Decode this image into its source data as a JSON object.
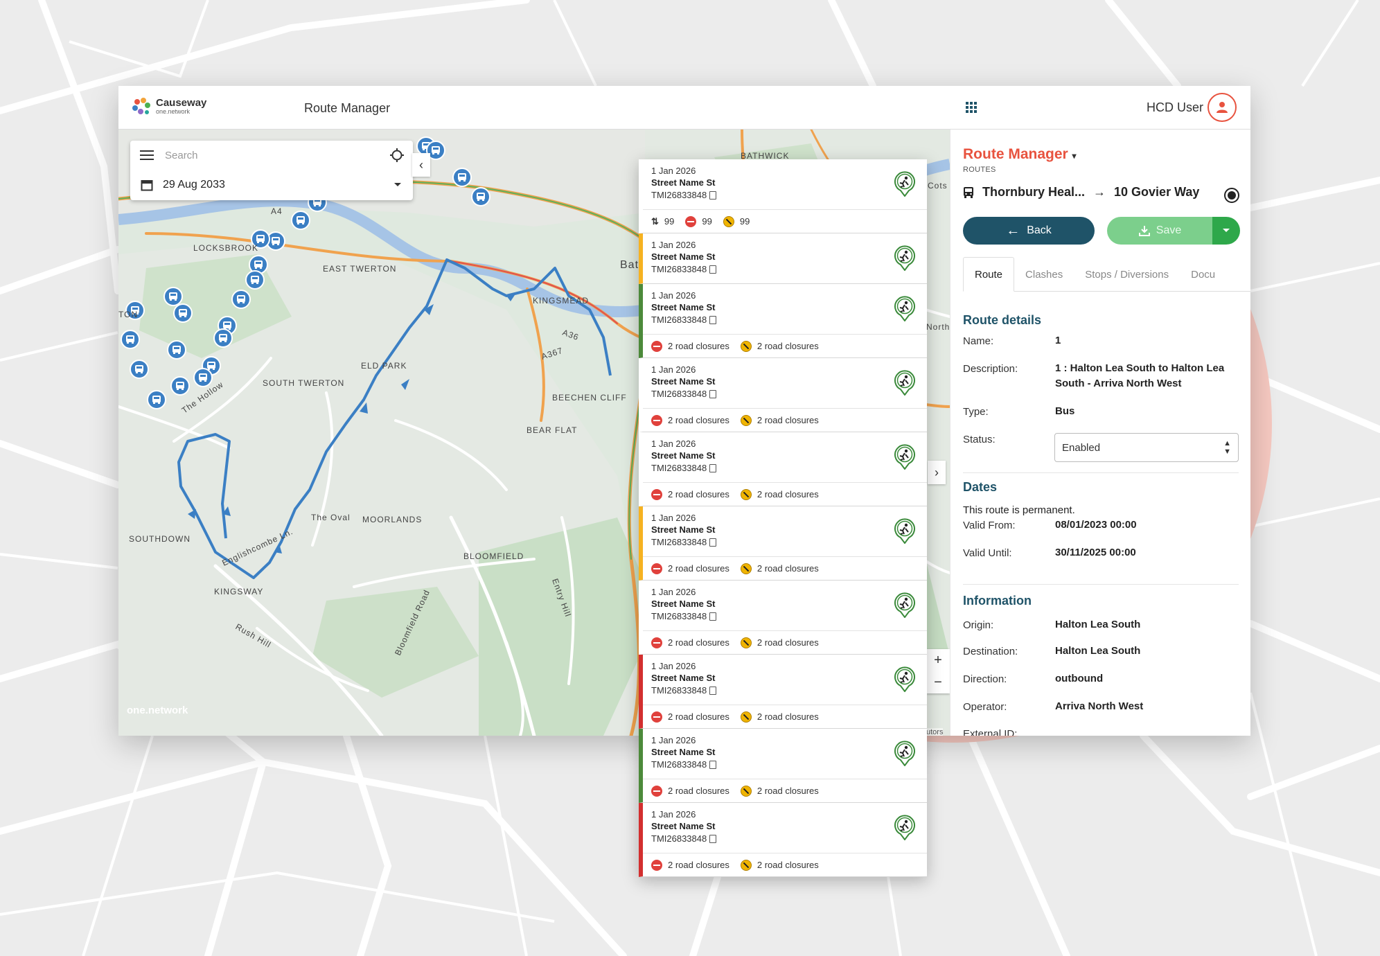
{
  "app": {
    "brand_name": "Causeway",
    "brand_sub": "one.network",
    "title": "Route Manager",
    "user_name": "HCD User"
  },
  "search": {
    "placeholder": "Search",
    "date": "29 Aug 2033"
  },
  "map": {
    "attribution": "one.network",
    "contributors": "utors",
    "labels": [
      "LOCKSBROOK",
      "EAST TWERTON",
      "KINGSMEAD",
      "A4",
      "A36",
      "A367",
      "Bat",
      "TON",
      "The Hollow",
      "SOUTH TWERTON",
      "ELD PARK",
      "BEECHEN CLIFF",
      "BEAR FLAT",
      "The Oval",
      "MOORLANDS",
      "SOUTHDOWN",
      "BLOOMFIELD",
      "KINGSWAY",
      "Englishcombe Ln.",
      "Rush Hill",
      "Bloomfield Road",
      "Entry Hill",
      "BATHWICK",
      "North",
      "Cots"
    ],
    "zoom_in": "+",
    "zoom_out": "−"
  },
  "events": {
    "summary": {
      "diversions": "99",
      "closures": "99",
      "restrictions": "99"
    },
    "items": [
      {
        "date": "1 Jan 2026",
        "street": "Street Name St",
        "ref": "TMI26833848",
        "status_color": "#ffffff",
        "closures": "",
        "restrictions": ""
      },
      {
        "date": "1 Jan 2026",
        "street": "Street Name St",
        "ref": "TMI26833848",
        "status_color": "#f6b221",
        "closures": "",
        "restrictions": ""
      },
      {
        "date": "1 Jan 2026",
        "street": "Street Name St",
        "ref": "TMI26833848",
        "status_color": "#4c8a3a",
        "closures": "2 road closures",
        "restrictions": "2 road closures"
      },
      {
        "date": "1 Jan 2026",
        "street": "Street Name St",
        "ref": "TMI26833848",
        "status_color": "#ffffff",
        "closures": "2 road closures",
        "restrictions": "2 road closures"
      },
      {
        "date": "1 Jan 2026",
        "street": "Street Name St",
        "ref": "TMI26833848",
        "status_color": "#ffffff",
        "closures": "2 road closures",
        "restrictions": "2 road closures"
      },
      {
        "date": "1 Jan 2026",
        "street": "Street Name St",
        "ref": "TMI26833848",
        "status_color": "#f6b221",
        "closures": "2 road closures",
        "restrictions": "2 road closures"
      },
      {
        "date": "1 Jan 2026",
        "street": "Street Name St",
        "ref": "TMI26833848",
        "status_color": "#ffffff",
        "closures": "2 road closures",
        "restrictions": "2 road closures"
      },
      {
        "date": "1 Jan 2026",
        "street": "Street Name St",
        "ref": "TMI26833848",
        "status_color": "#d32f2f",
        "closures": "2 road closures",
        "restrictions": "2 road closures"
      },
      {
        "date": "1 Jan 2026",
        "street": "Street Name St",
        "ref": "TMI26833848",
        "status_color": "#4c8a3a",
        "closures": "2 road closures",
        "restrictions": "2 road closures"
      },
      {
        "date": "1 Jan 2026",
        "street": "Street Name St",
        "ref": "TMI26833848",
        "status_color": "#d32f2f",
        "closures": "2 road closures",
        "restrictions": "2 road closures"
      }
    ]
  },
  "side": {
    "title": "Route Manager",
    "subtitle": "ROUTES",
    "route_from": "Thornbury Heal...",
    "route_to": "10 Govier Way",
    "back_label": "Back",
    "save_label": "Save",
    "tabs": [
      "Route",
      "Clashes",
      "Stops / Diversions",
      "Docu"
    ],
    "route_details_title": "Route details",
    "name_label": "Name:",
    "name_value": "1",
    "description_label": "Description:",
    "description_value": "1 : Halton Lea South to Halton Lea South - Arriva North West",
    "type_label": "Type:",
    "type_value": "Bus",
    "status_label": "Status:",
    "status_value": "Enabled",
    "dates_title": "Dates",
    "permanent_text": "This route is permanent.",
    "valid_from_label": "Valid From:",
    "valid_from_value": "08/01/2023 00:00",
    "valid_until_label": "Valid Until:",
    "valid_until_value": "30/11/2025 00:00",
    "information_title": "Information",
    "origin_label": "Origin:",
    "origin_value": "Halton Lea South",
    "destination_label": "Destination:",
    "destination_value": "Halton Lea South",
    "direction_label": "Direction:",
    "direction_value": "outbound",
    "operator_label": "Operator:",
    "operator_value": "Arriva North West",
    "external_id_label": "External ID:"
  },
  "colors": {
    "accent": "#e8533f",
    "primary": "#1f5368",
    "save": "#7ccf8c",
    "route": "#3b7fc4",
    "circle": "#f6c9c1"
  }
}
